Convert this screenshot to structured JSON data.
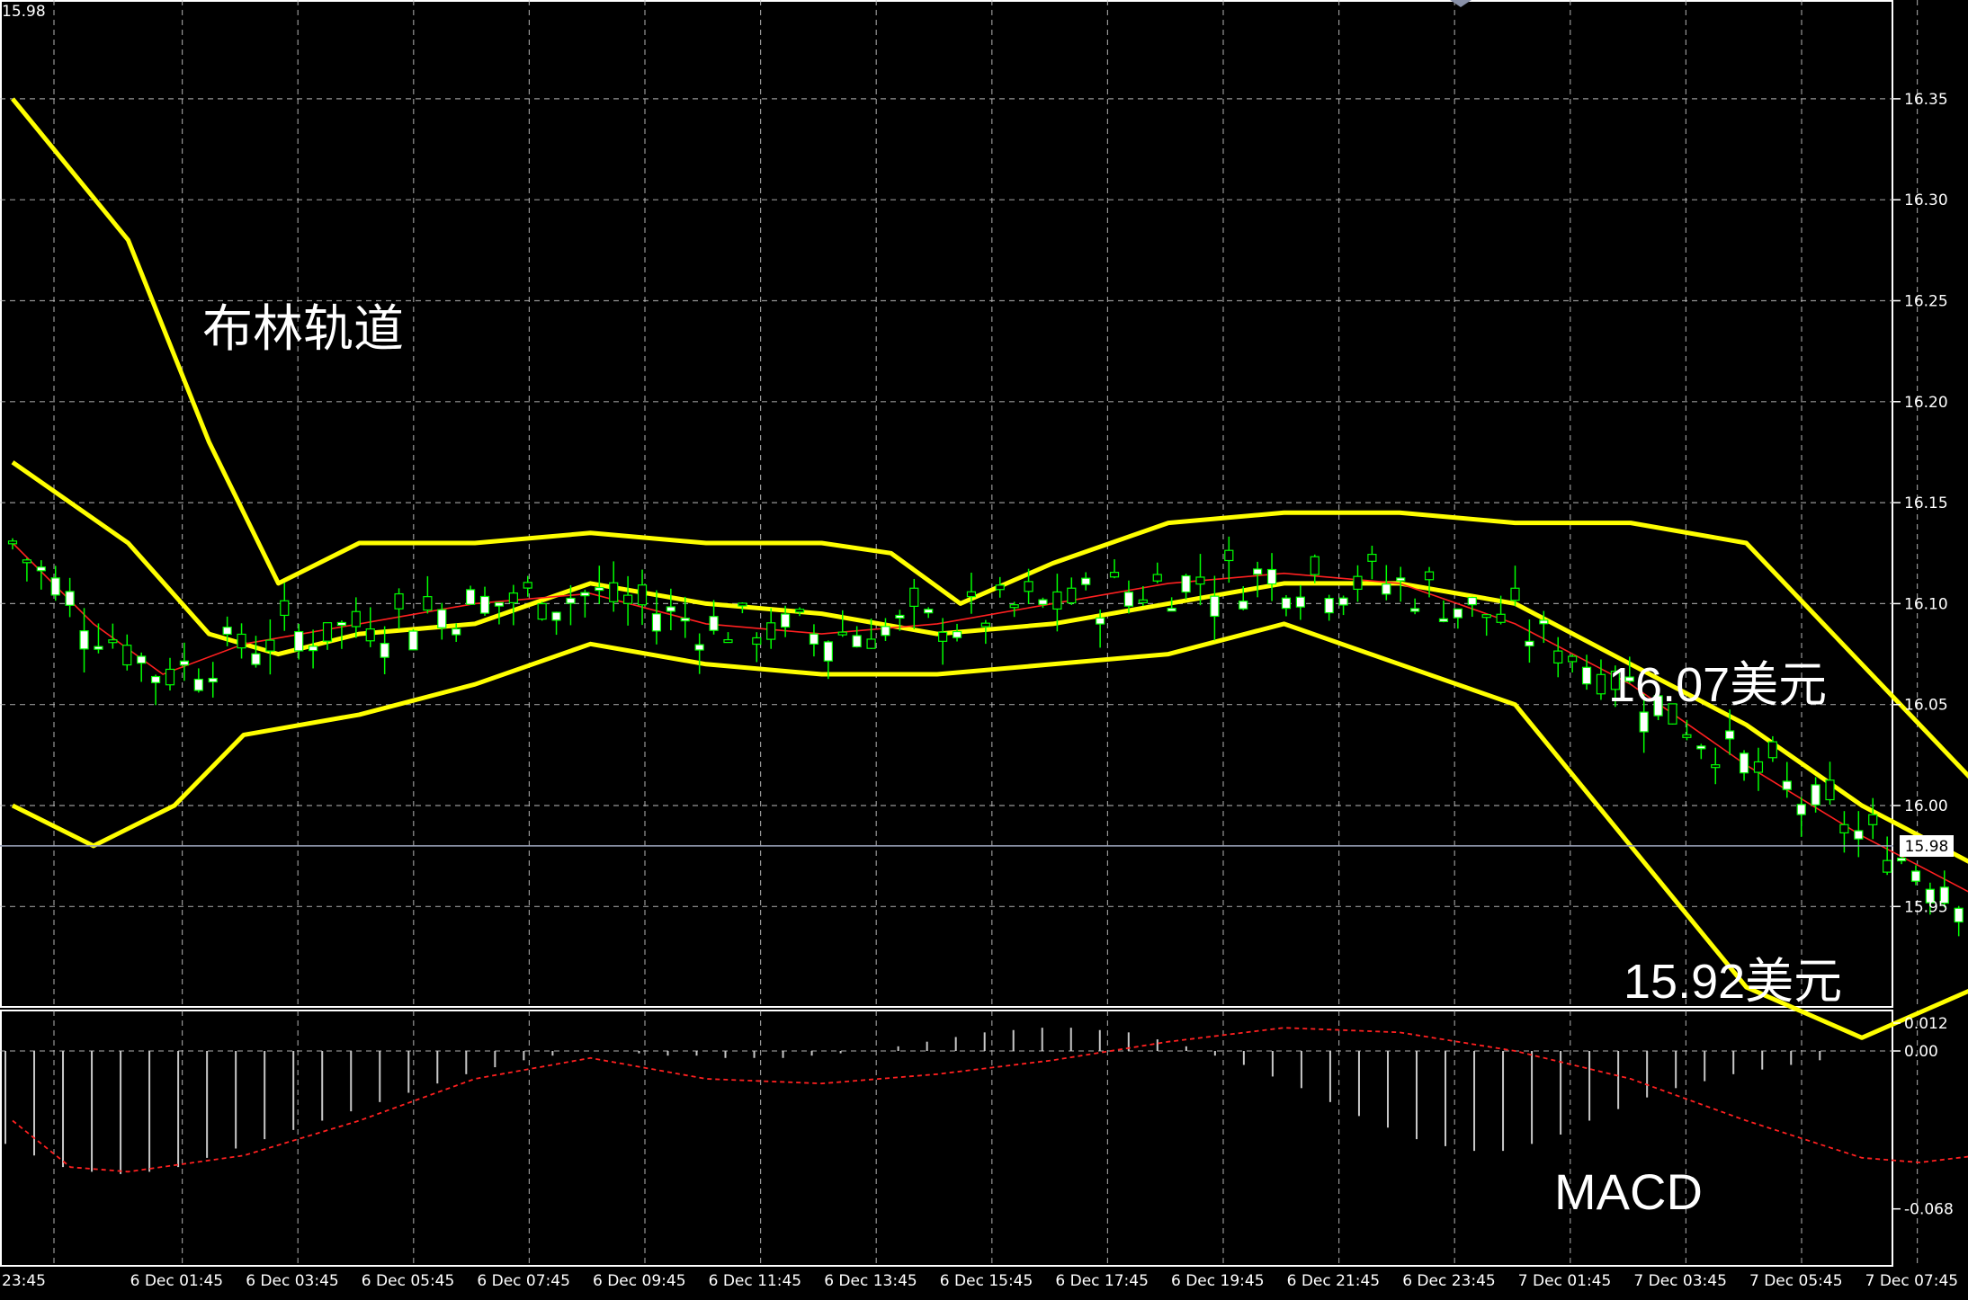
{
  "corner_price": "15.98",
  "annotations": {
    "bollinger": "布林轨道",
    "upper_price": "16.07美元",
    "lower_price": "15.92美元",
    "macd": "MACD"
  },
  "colors": {
    "background": "#000000",
    "grid": "#c8c8c8",
    "bollinger_band": "#ffff00",
    "moving_average": "#ff2020",
    "candle_wick": "#00ff00",
    "bull_body": "#ffffff",
    "bear_body": "#000000",
    "macd_hist": "#c8c8c8",
    "macd_signal": "#ff2020",
    "current_price_line": "#a0a8c0"
  },
  "chart_data": {
    "type": "candlestick",
    "price_axis": {
      "ticks": [
        "16.35",
        "16.30",
        "16.25",
        "16.20",
        "16.15",
        "16.10",
        "16.05",
        "16.00",
        "15.95"
      ],
      "range": [
        15.9,
        16.4
      ],
      "current_price": "15.98"
    },
    "time_axis": {
      "labels": [
        "23:45",
        "6 Dec 01:45",
        "6 Dec 03:45",
        "6 Dec 05:45",
        "6 Dec 07:45",
        "6 Dec 09:45",
        "6 Dec 11:45",
        "6 Dec 13:45",
        "6 Dec 15:45",
        "6 Dec 17:45",
        "6 Dec 19:45",
        "6 Dec 21:45",
        "6 Dec 23:45",
        "7 Dec 01:45",
        "7 Dec 03:45",
        "7 Dec 05:45",
        "7 Dec 07:45"
      ]
    },
    "bollinger": {
      "period_note": "",
      "upper": [
        [
          0,
          16.35
        ],
        [
          1.0,
          16.28
        ],
        [
          1.7,
          16.18
        ],
        [
          2.3,
          16.11
        ],
        [
          3.0,
          16.13
        ],
        [
          4.0,
          16.13
        ],
        [
          5.0,
          16.135
        ],
        [
          6.0,
          16.13
        ],
        [
          7.0,
          16.13
        ],
        [
          7.6,
          16.125
        ],
        [
          8.2,
          16.1
        ],
        [
          9.0,
          16.12
        ],
        [
          10.0,
          16.14
        ],
        [
          11.0,
          16.145
        ],
        [
          12.0,
          16.145
        ],
        [
          13.0,
          16.14
        ],
        [
          14.0,
          16.14
        ],
        [
          15.0,
          16.13
        ],
        [
          16.0,
          16.07
        ],
        [
          17.0,
          16.01
        ],
        [
          17.8,
          15.99
        ],
        [
          18.0,
          16.0
        ],
        [
          19.0,
          16.0
        ],
        [
          20.0,
          15.995
        ],
        [
          20.8,
          15.99
        ]
      ],
      "middle": [
        [
          0,
          16.17
        ],
        [
          1.0,
          16.13
        ],
        [
          1.7,
          16.085
        ],
        [
          2.3,
          16.075
        ],
        [
          3.0,
          16.085
        ],
        [
          4.0,
          16.09
        ],
        [
          5.0,
          16.11
        ],
        [
          6.0,
          16.1
        ],
        [
          7.0,
          16.095
        ],
        [
          8.0,
          16.085
        ],
        [
          9.0,
          16.09
        ],
        [
          10.0,
          16.1
        ],
        [
          11.0,
          16.11
        ],
        [
          12.0,
          16.11
        ],
        [
          13.0,
          16.1
        ],
        [
          14.0,
          16.07
        ],
        [
          15.0,
          16.04
        ],
        [
          16.0,
          16.0
        ],
        [
          17.0,
          15.97
        ],
        [
          18.0,
          15.955
        ],
        [
          19.0,
          15.955
        ],
        [
          20.0,
          15.965
        ],
        [
          20.8,
          15.97
        ]
      ],
      "lower": [
        [
          0,
          16.0
        ],
        [
          0.7,
          15.98
        ],
        [
          1.4,
          16.0
        ],
        [
          2.0,
          16.035
        ],
        [
          3.0,
          16.045
        ],
        [
          4.0,
          16.06
        ],
        [
          5.0,
          16.08
        ],
        [
          6.0,
          16.07
        ],
        [
          7.0,
          16.065
        ],
        [
          8.0,
          16.065
        ],
        [
          9.0,
          16.07
        ],
        [
          10.0,
          16.075
        ],
        [
          11.0,
          16.09
        ],
        [
          12.0,
          16.07
        ],
        [
          13.0,
          16.05
        ],
        [
          14.0,
          15.98
        ],
        [
          15.0,
          15.91
        ],
        [
          16.0,
          15.885
        ],
        [
          17.0,
          15.91
        ],
        [
          18.0,
          15.92
        ],
        [
          19.0,
          15.925
        ],
        [
          20.0,
          15.935
        ],
        [
          20.8,
          15.94
        ]
      ]
    },
    "moving_average": [
      [
        0,
        16.13
      ],
      [
        0.7,
        16.09
      ],
      [
        1.3,
        16.065
      ],
      [
        2.0,
        16.08
      ],
      [
        3.0,
        16.09
      ],
      [
        4.0,
        16.1
      ],
      [
        5.0,
        16.105
      ],
      [
        6.0,
        16.09
      ],
      [
        7.0,
        16.085
      ],
      [
        8.0,
        16.09
      ],
      [
        9.0,
        16.1
      ],
      [
        10.0,
        16.11
      ],
      [
        11.0,
        16.115
      ],
      [
        12.0,
        16.11
      ],
      [
        13.0,
        16.09
      ],
      [
        14.0,
        16.06
      ],
      [
        15.0,
        16.02
      ],
      [
        16.0,
        15.985
      ],
      [
        17.0,
        15.955
      ],
      [
        18.0,
        15.96
      ],
      [
        19.0,
        15.97
      ],
      [
        20.0,
        15.97
      ],
      [
        20.8,
        15.975
      ]
    ],
    "macd": {
      "axis_ticks": [
        "0.012",
        "0.00",
        "-0.068"
      ],
      "range": [
        -0.068,
        0.012
      ],
      "histogram": [
        -0.04,
        -0.045,
        -0.05,
        -0.052,
        -0.053,
        -0.052,
        -0.05,
        -0.046,
        -0.042,
        -0.038,
        -0.034,
        -0.03,
        -0.026,
        -0.022,
        -0.018,
        -0.014,
        -0.01,
        -0.007,
        -0.004,
        -0.002,
        0.0,
        0.0,
        -0.001,
        -0.002,
        -0.002,
        -0.003,
        -0.003,
        -0.003,
        -0.002,
        -0.001,
        0.0,
        0.002,
        0.004,
        0.006,
        0.008,
        0.009,
        0.01,
        0.01,
        0.009,
        0.008,
        0.005,
        0.002,
        -0.002,
        -0.006,
        -0.011,
        -0.016,
        -0.022,
        -0.028,
        -0.033,
        -0.038,
        -0.041,
        -0.043,
        -0.043,
        -0.04,
        -0.036,
        -0.03,
        -0.025,
        -0.02,
        -0.016,
        -0.013,
        -0.01,
        -0.008,
        -0.006,
        -0.004
      ],
      "signal": [
        [
          0,
          -0.03
        ],
        [
          0.5,
          -0.05
        ],
        [
          1.0,
          -0.052
        ],
        [
          2.0,
          -0.045
        ],
        [
          3.0,
          -0.03
        ],
        [
          4.0,
          -0.012
        ],
        [
          5.0,
          -0.003
        ],
        [
          6.0,
          -0.012
        ],
        [
          7.0,
          -0.014
        ],
        [
          8.0,
          -0.01
        ],
        [
          9.0,
          -0.004
        ],
        [
          10.0,
          0.004
        ],
        [
          11.0,
          0.01
        ],
        [
          12.0,
          0.008
        ],
        [
          13.0,
          0.0
        ],
        [
          14.0,
          -0.012
        ],
        [
          15.0,
          -0.03
        ],
        [
          16.0,
          -0.046
        ],
        [
          16.5,
          -0.048
        ],
        [
          17.0,
          -0.045
        ],
        [
          18.0,
          -0.035
        ],
        [
          19.0,
          -0.022
        ],
        [
          20.0,
          -0.02
        ],
        [
          20.8,
          -0.018
        ]
      ]
    }
  }
}
